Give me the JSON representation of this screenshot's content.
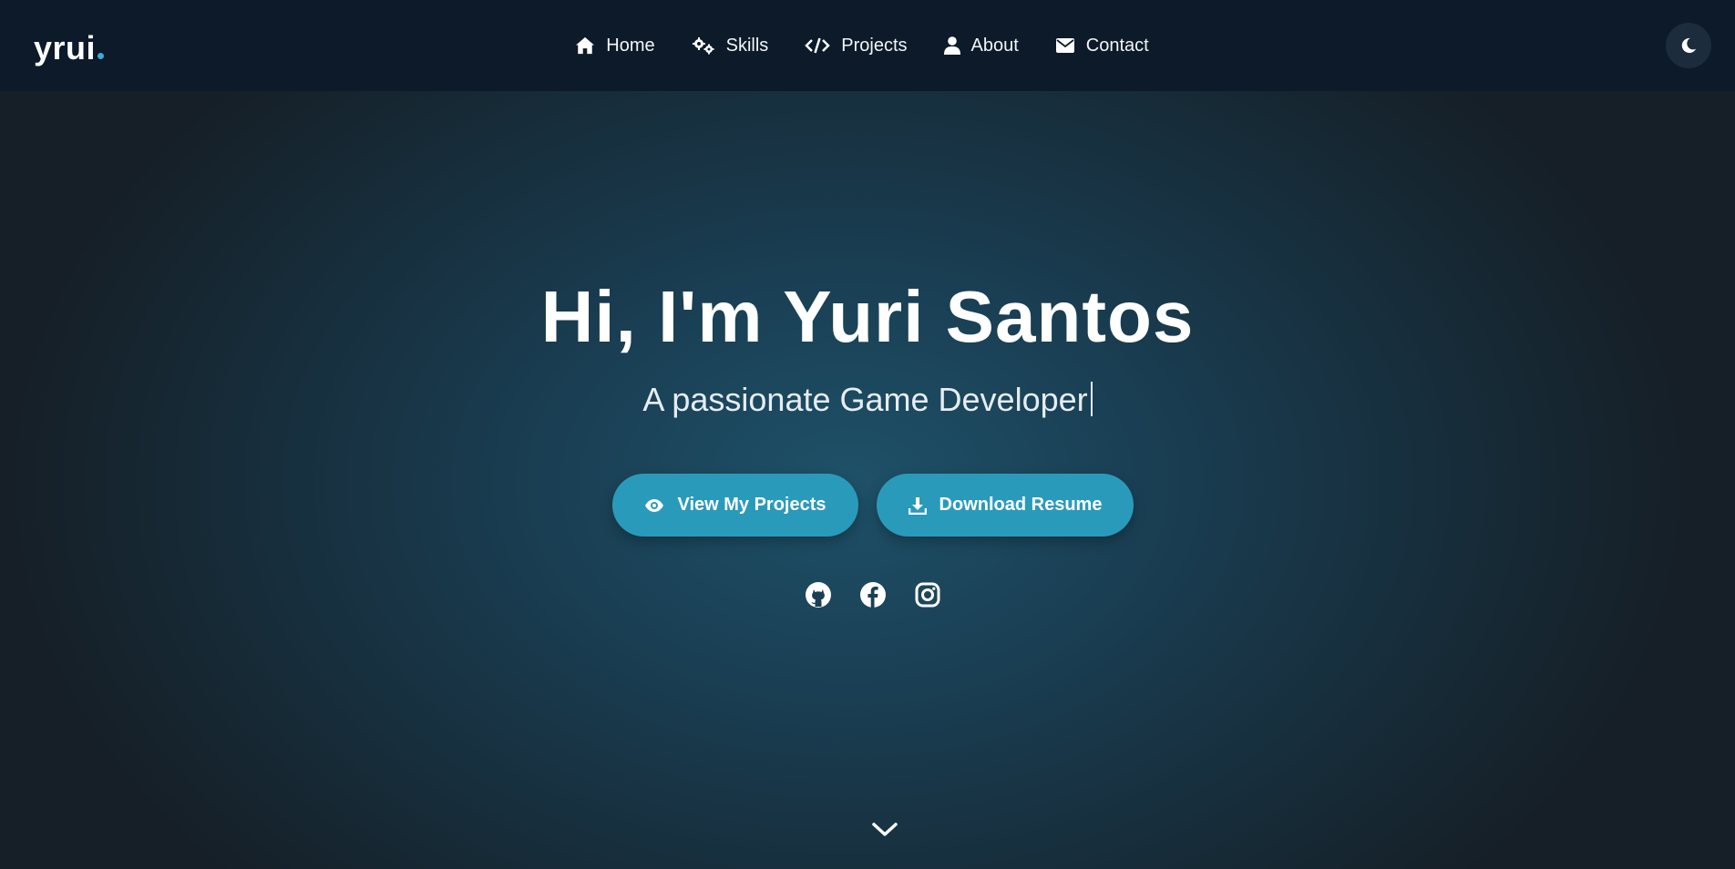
{
  "logo": {
    "text": "yrui",
    "dot_color": "#3ea8d8"
  },
  "nav": {
    "items": [
      {
        "label": "Home",
        "icon": "home-icon"
      },
      {
        "label": "Skills",
        "icon": "gears-icon"
      },
      {
        "label": "Projects",
        "icon": "code-icon"
      },
      {
        "label": "About",
        "icon": "user-icon"
      },
      {
        "label": "Contact",
        "icon": "envelope-icon"
      }
    ],
    "theme_toggle_icon": "moon-icon"
  },
  "hero": {
    "title": "Hi, I'm Yuri Santos",
    "subtitle": "A passionate Game Developer",
    "buttons": {
      "projects_label": "View My Projects",
      "projects_icon": "eye-icon",
      "resume_label": "Download Resume",
      "resume_icon": "download-icon"
    },
    "socials": [
      "github-icon",
      "facebook-icon",
      "instagram-icon"
    ],
    "scroll_icon": "chevron-down-icon"
  },
  "colors": {
    "nav_bg": "#0c1a29",
    "accent": "#2a9aba",
    "hero_center": "#1e5168",
    "hero_edge": "#161f27"
  }
}
